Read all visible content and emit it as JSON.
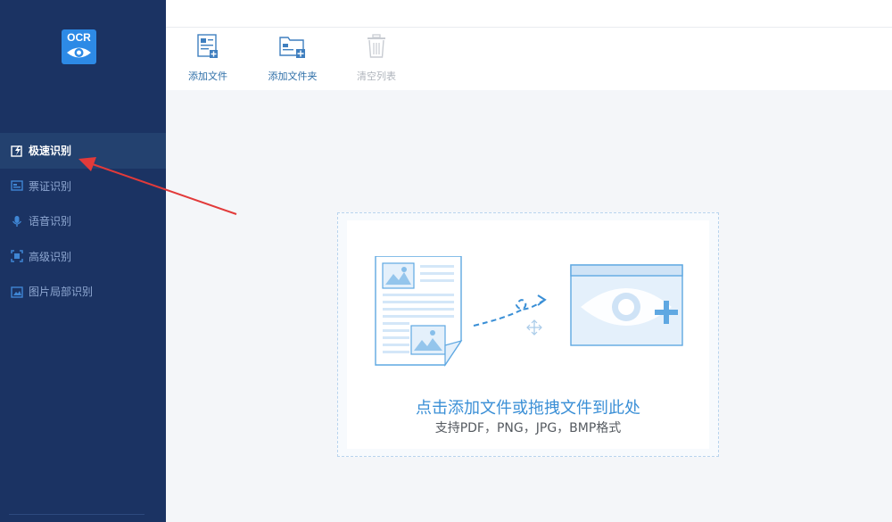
{
  "app": {
    "logo_text": "OCR",
    "logo_color": "#2d8ae6",
    "sidebar_bg": "#1b3363",
    "accent": "#3a8fd6"
  },
  "sidebar": {
    "items": [
      {
        "label": "极速识别",
        "icon": "lightning-edit-icon",
        "active": true
      },
      {
        "label": "票证识别",
        "icon": "ticket-icon",
        "active": false
      },
      {
        "label": "语音识别",
        "icon": "microphone-icon",
        "active": false
      },
      {
        "label": "高级识别",
        "icon": "scan-frame-icon",
        "active": false
      },
      {
        "label": "图片局部识别",
        "icon": "image-crop-icon",
        "active": false
      }
    ]
  },
  "toolbar": {
    "add_file": "添加文件",
    "add_folder": "添加文件夹",
    "clear_list": "清空列表"
  },
  "dropzone": {
    "title": "点击添加文件或拖拽文件到此处",
    "subtitle": "支持PDF，PNG，JPG，BMP格式"
  }
}
